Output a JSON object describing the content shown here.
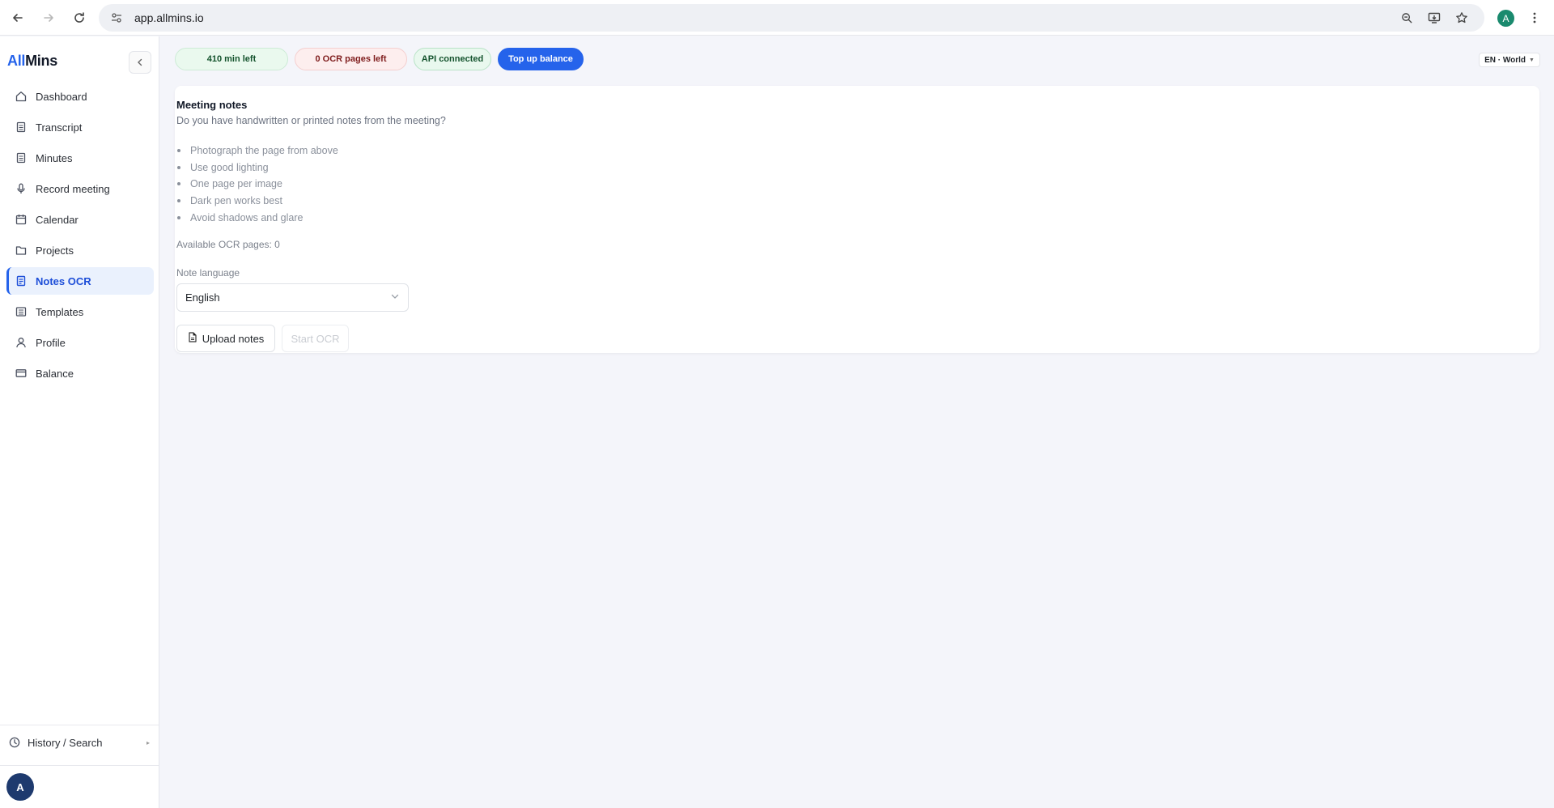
{
  "browser": {
    "url": "app.allmins.io",
    "profile_initial": "A"
  },
  "sidebar": {
    "logo_part1": "All",
    "logo_part2": "Mins",
    "items": [
      {
        "label": "Dashboard",
        "icon": "home-icon"
      },
      {
        "label": "Transcript",
        "icon": "document-icon"
      },
      {
        "label": "Minutes",
        "icon": "document-icon"
      },
      {
        "label": "Record meeting",
        "icon": "microphone-icon"
      },
      {
        "label": "Calendar",
        "icon": "calendar-icon"
      },
      {
        "label": "Projects",
        "icon": "folder-icon"
      },
      {
        "label": "Notes OCR",
        "icon": "document-scan-icon",
        "active": true
      },
      {
        "label": "Templates",
        "icon": "list-icon"
      },
      {
        "label": "Profile",
        "icon": "user-icon"
      },
      {
        "label": "Balance",
        "icon": "credit-card-icon"
      }
    ],
    "history_label": "History / Search",
    "user_initial": "A"
  },
  "topbar": {
    "minutes_left": "410 min left",
    "ocr_pages_left": "0 OCR pages left",
    "api_status": "API connected",
    "topup_label": "Top up balance",
    "locale": "EN · World"
  },
  "colors": {
    "accent": "#2563eb",
    "success_bg": "#eaf9ee",
    "danger_bg": "#fdeeee"
  },
  "notes": {
    "title": "Meeting notes",
    "subtitle": "Do you have handwritten or printed notes from the meeting?",
    "tips": [
      "Photograph the page from above",
      "Use good lighting",
      "One page per image",
      "Dark pen works best",
      "Avoid shadows and glare"
    ],
    "available_pages": "Available OCR pages: 0",
    "language_label": "Note language",
    "language_value": "English",
    "upload_label": "Upload notes",
    "start_label": "Start OCR"
  }
}
